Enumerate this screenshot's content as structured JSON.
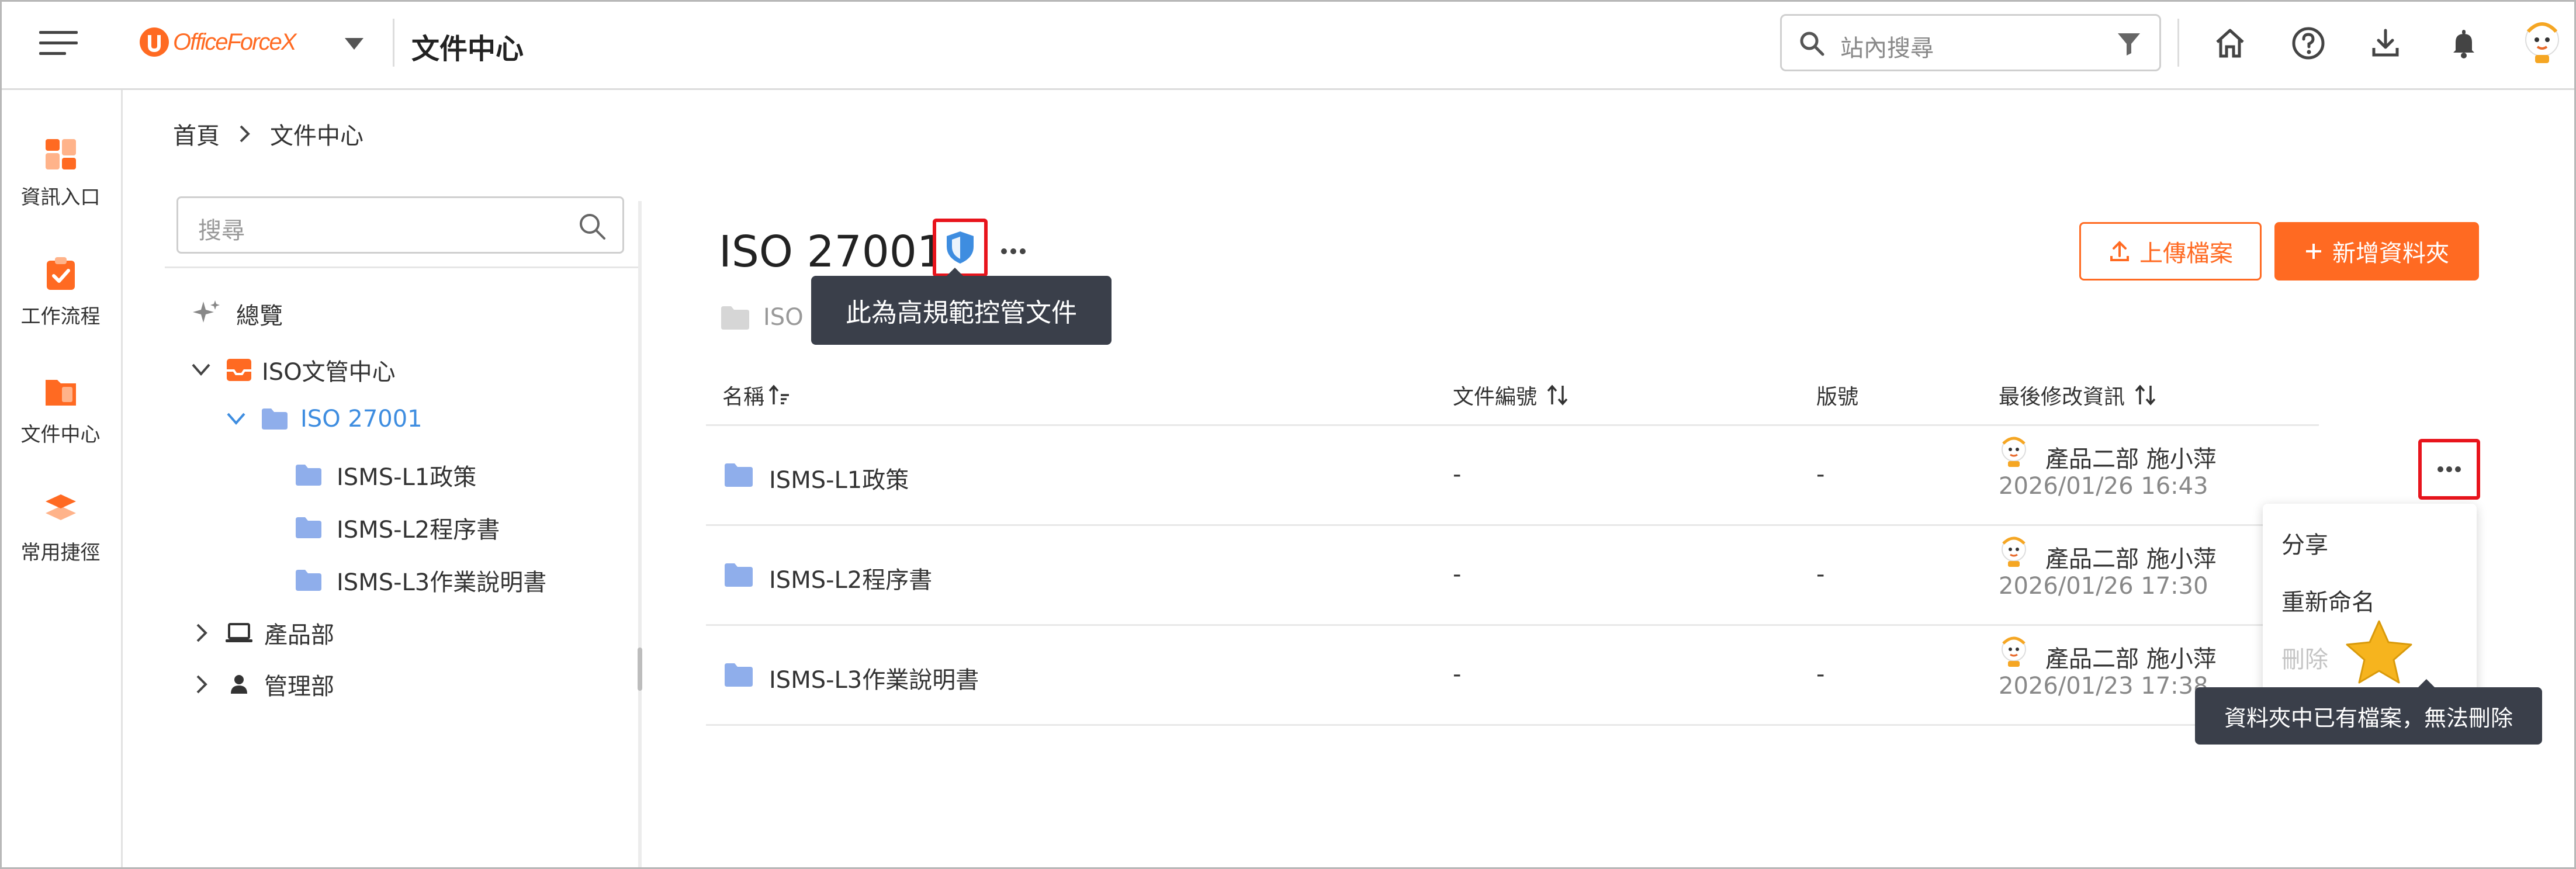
{
  "app": {
    "logo_text": "OfficeForceX",
    "title": "文件中心"
  },
  "search": {
    "placeholder": "站內搜尋"
  },
  "sidebar": {
    "items": [
      {
        "label": "資訊入口",
        "icon": "dashboard-icon"
      },
      {
        "label": "工作流程",
        "icon": "workflow-icon"
      },
      {
        "label": "文件中心",
        "icon": "file-center-icon"
      },
      {
        "label": "常用捷徑",
        "icon": "shortcut-icon"
      }
    ]
  },
  "breadcrumb": {
    "home": "首頁",
    "current": "文件中心"
  },
  "tree": {
    "search_placeholder": "搜尋",
    "overview": "總覽",
    "iso_center": "ISO文管中心",
    "iso27001": "ISO 27001",
    "children": [
      "ISMS-L1政策",
      "ISMS-L2程序書",
      "ISMS-L3作業說明書"
    ],
    "product_dept": "產品部",
    "mgmt_dept": "管理部"
  },
  "main": {
    "title": "ISO 27001",
    "path_fragment": "ISO",
    "shield_tooltip": "此為高規範控管文件",
    "upload_label": "上傳檔案",
    "new_folder_label": "新增資料夾"
  },
  "table": {
    "headers": {
      "name": "名稱",
      "doc_no": "文件編號",
      "version": "版號",
      "modified": "最後修改資訊"
    },
    "rows": [
      {
        "name": "ISMS-L1政策",
        "doc_no": "-",
        "version": "-",
        "user": "產品二部 施小萍",
        "date": "2026/01/26 16:43"
      },
      {
        "name": "ISMS-L2程序書",
        "doc_no": "-",
        "version": "-",
        "user": "產品二部 施小萍",
        "date": "2026/01/26 17:30"
      },
      {
        "name": "ISMS-L3作業說明書",
        "doc_no": "-",
        "version": "-",
        "user": "產品二部 施小萍",
        "date": "2026/01/23 17:38"
      }
    ]
  },
  "context_menu": {
    "share": "分享",
    "rename": "重新命名",
    "delete": "刪除"
  },
  "delete_tooltip": "資料夾中已有檔案，無法刪除",
  "colors": {
    "accent": "#FF6A22",
    "folder_blue": "#8FAEEB",
    "highlight_red": "#E8141C",
    "tree_active": "#3E8DE0",
    "tooltip_bg": "#3A3F4A"
  }
}
